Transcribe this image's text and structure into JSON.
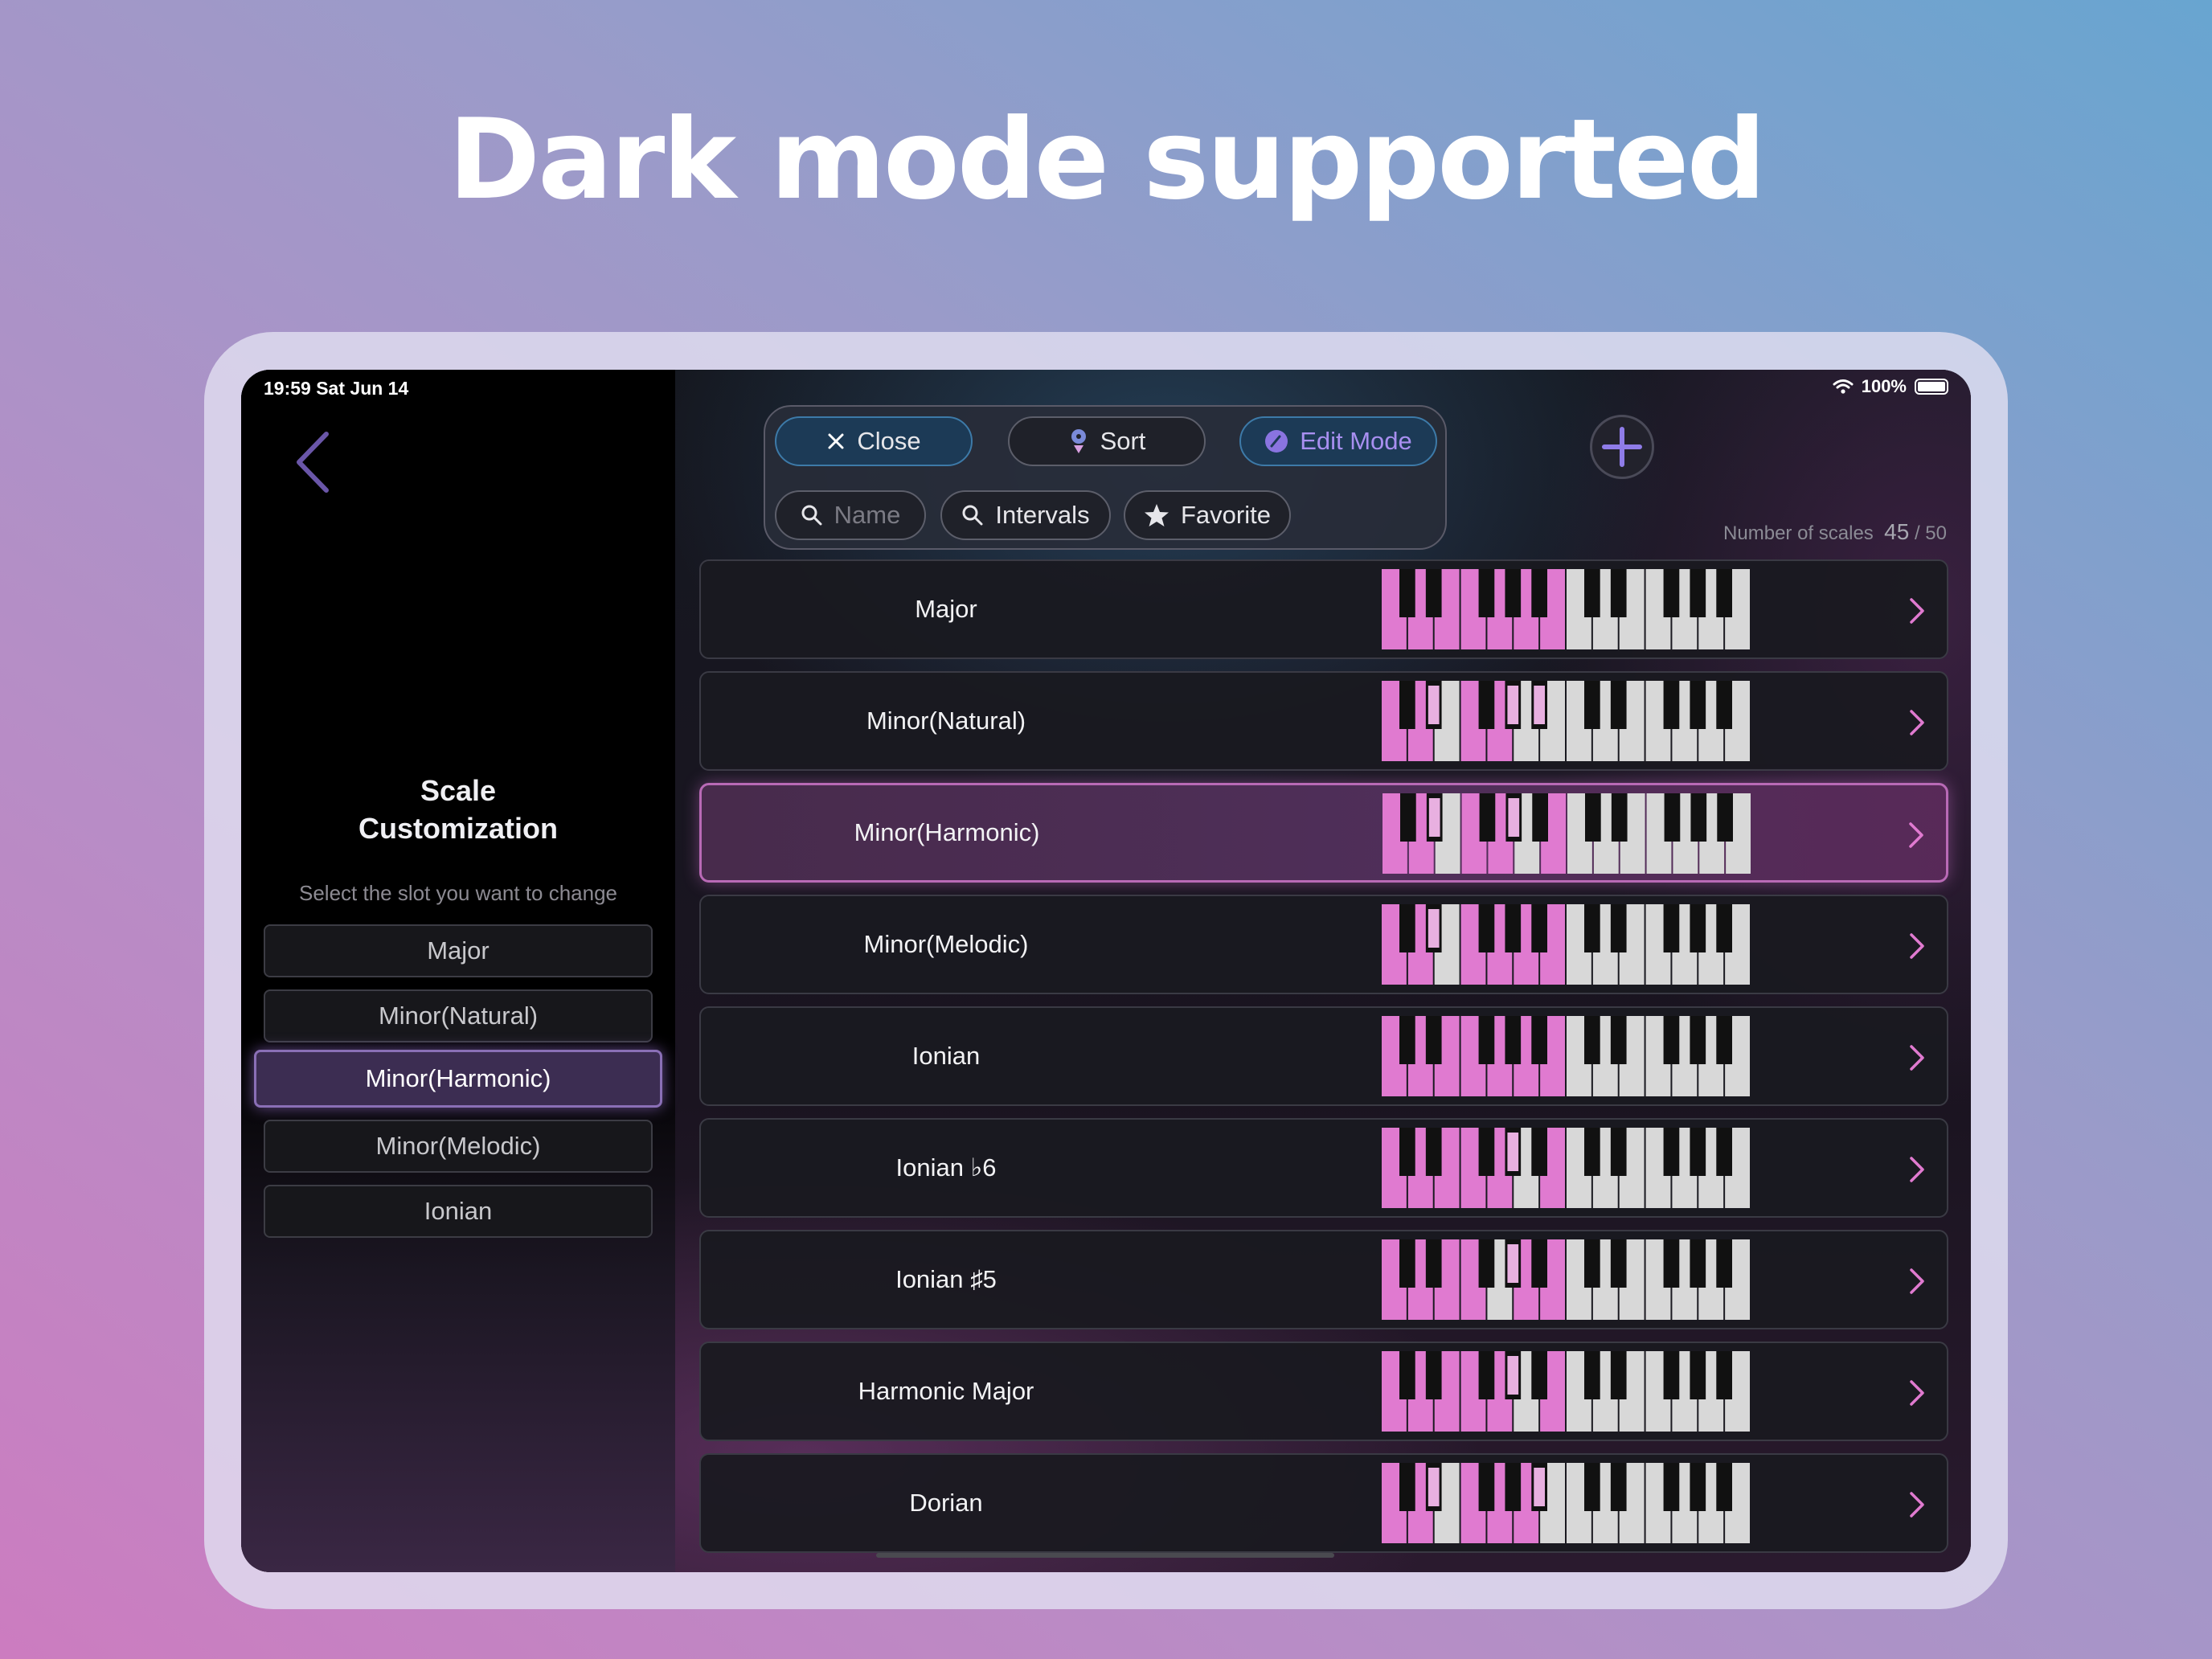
{
  "headline": "Dark mode supported",
  "status_bar": {
    "time": "19:59  Sat Jun 14",
    "battery": "100%"
  },
  "left_panel": {
    "title_line1": "Scale",
    "title_line2": "Customization",
    "subtitle": "Select the slot you want to change",
    "slots": [
      {
        "label": "Major",
        "selected": false
      },
      {
        "label": "Minor(Natural)",
        "selected": false
      },
      {
        "label": "Minor(Harmonic)",
        "selected": true
      },
      {
        "label": "Minor(Melodic)",
        "selected": false
      },
      {
        "label": "Ionian",
        "selected": false
      }
    ]
  },
  "toolbar": {
    "close": "Close",
    "sort": "Sort",
    "edit_mode": "Edit Mode",
    "name_placeholder": "Name",
    "intervals": "Intervals",
    "favorite": "Favorite"
  },
  "count": {
    "label": "Number of scales",
    "value": "45",
    "max": "/ 50"
  },
  "colors": {
    "highlight": "#e07ad0",
    "white_key": "#d8d8d8",
    "black_key": "#111111",
    "accent": "#a88ff0"
  },
  "scales": [
    {
      "name": "Major",
      "notes": [
        0,
        2,
        4,
        5,
        7,
        9,
        11
      ],
      "selected": false
    },
    {
      "name": "Minor(Natural)",
      "notes": [
        0,
        2,
        3,
        5,
        7,
        8,
        10
      ],
      "selected": false
    },
    {
      "name": "Minor(Harmonic)",
      "notes": [
        0,
        2,
        3,
        5,
        7,
        8,
        11
      ],
      "selected": true
    },
    {
      "name": "Minor(Melodic)",
      "notes": [
        0,
        2,
        3,
        5,
        7,
        9,
        11
      ],
      "selected": false
    },
    {
      "name": "Ionian",
      "notes": [
        0,
        2,
        4,
        5,
        7,
        9,
        11
      ],
      "selected": false
    },
    {
      "name": "Ionian ♭6",
      "notes": [
        0,
        2,
        4,
        5,
        7,
        8,
        11
      ],
      "selected": false
    },
    {
      "name": "Ionian ♯5",
      "notes": [
        0,
        2,
        4,
        5,
        8,
        9,
        11
      ],
      "selected": false
    },
    {
      "name": "Harmonic Major",
      "notes": [
        0,
        2,
        4,
        5,
        7,
        8,
        11
      ],
      "selected": false
    },
    {
      "name": "Dorian",
      "notes": [
        0,
        2,
        3,
        5,
        7,
        9,
        10
      ],
      "selected": false
    }
  ]
}
